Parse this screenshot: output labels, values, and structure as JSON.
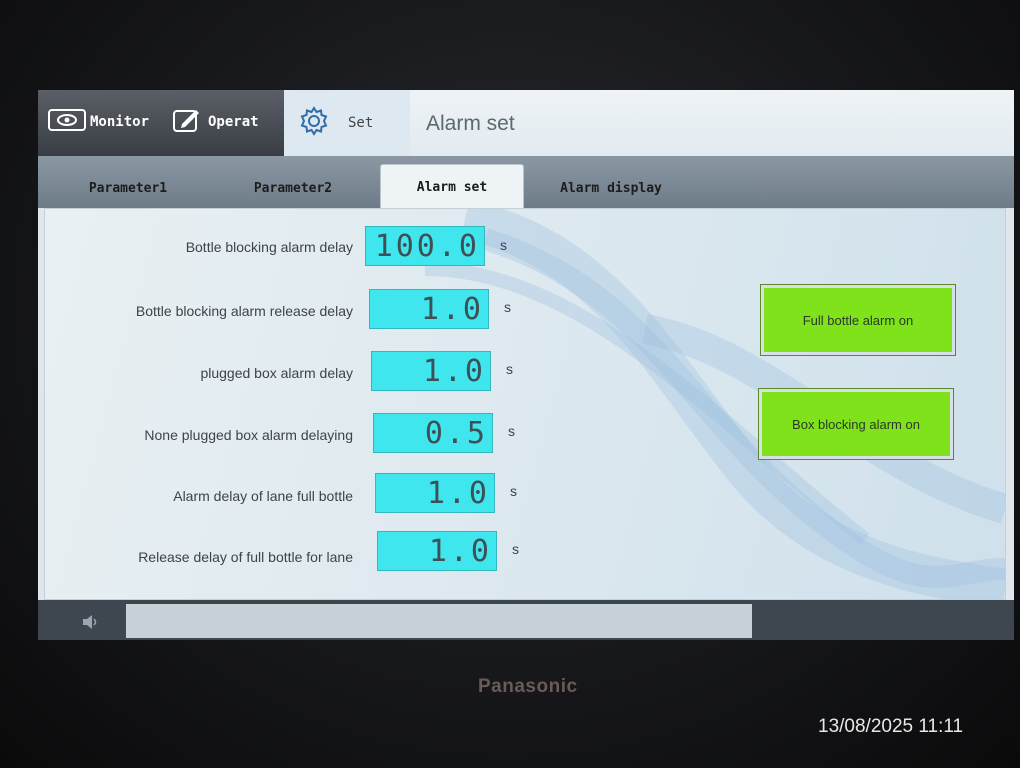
{
  "nav": {
    "monitor_label": "Monitor",
    "operat_label": "Operat",
    "set_label": "Set",
    "title": "Alarm set"
  },
  "tabs": [
    {
      "label": "Parameter1",
      "active": false
    },
    {
      "label": "Parameter2",
      "active": false
    },
    {
      "label": "Alarm set",
      "active": true
    },
    {
      "label": "Alarm display",
      "active": false
    }
  ],
  "parameters": [
    {
      "label": "Bottle blocking alarm delay",
      "value": "100.0",
      "unit": "s"
    },
    {
      "label": "Bottle blocking alarm release delay",
      "value": "1.0",
      "unit": "s"
    },
    {
      "label": "plugged box alarm delay",
      "value": "1.0",
      "unit": "s"
    },
    {
      "label": "None plugged box alarm delaying",
      "value": "0.5",
      "unit": "s"
    },
    {
      "label": "Alarm delay of lane full bottle",
      "value": "1.0",
      "unit": "s"
    },
    {
      "label": "Release delay of full bottle for lane",
      "value": "1.0",
      "unit": "s"
    }
  ],
  "alarm_buttons": {
    "full_bottle": "Full bottle alarm on",
    "box_blocking": "Box blocking alarm on"
  },
  "device": {
    "brand": "Panasonic"
  },
  "photo": {
    "timestamp": "13/08/2025 11:11"
  },
  "colors": {
    "value_box": "#3fe6ee",
    "alarm_button": "#7fe21a",
    "nav_dark": "#3a3d44"
  },
  "icons": {
    "monitor": "monitor-icon",
    "operat": "edit-icon",
    "set": "gear-icon",
    "status": "speaker-icon"
  }
}
